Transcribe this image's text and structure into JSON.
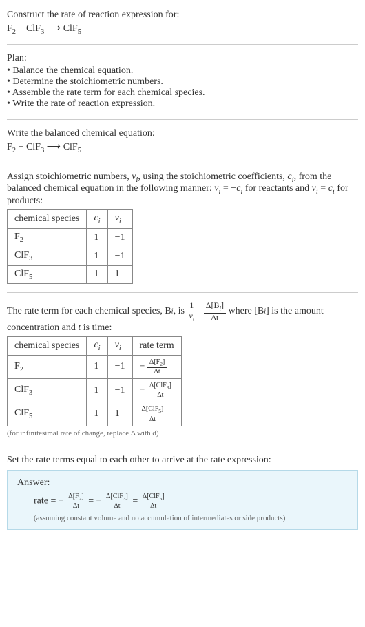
{
  "intro": {
    "prompt": "Construct the rate of reaction expression for:",
    "equation_lhs1": "F",
    "equation_lhs1_sub": "2",
    "plus": " + ",
    "equation_lhs2": "ClF",
    "equation_lhs2_sub": "3",
    "arrow": " ⟶ ",
    "equation_rhs": "ClF",
    "equation_rhs_sub": "5"
  },
  "plan": {
    "heading": "Plan:",
    "items": [
      "Balance the chemical equation.",
      "Determine the stoichiometric numbers.",
      "Assemble the rate term for each chemical species.",
      "Write the rate of reaction expression."
    ]
  },
  "balance": {
    "heading": "Write the balanced chemical equation:"
  },
  "assign": {
    "text_a": "Assign stoichiometric numbers, ",
    "nu_i": "ν",
    "i_sub": "i",
    "text_b": ", using the stoichiometric coefficients, ",
    "c_i": "c",
    "text_c": ", from the balanced chemical equation in the following manner: ",
    "rel1_lhs": "ν",
    "rel1_eq": " = −",
    "rel1_rhs": "c",
    "text_d": " for reactants and ",
    "rel2_eq": " = ",
    "text_e": " for products:"
  },
  "table1": {
    "h1": "chemical species",
    "h2": "c",
    "h2_sub": "i",
    "h3": "ν",
    "h3_sub": "i",
    "rows": [
      {
        "sp": "F",
        "sp_sub": "2",
        "c": "1",
        "nu": "−1"
      },
      {
        "sp": "ClF",
        "sp_sub": "3",
        "c": "1",
        "nu": "−1"
      },
      {
        "sp": "ClF",
        "sp_sub": "5",
        "c": "1",
        "nu": "1"
      }
    ]
  },
  "rateterm": {
    "text_a": "The rate term for each chemical species, B",
    "i_sub": "i",
    "text_b": ", is ",
    "frac1_num": "1",
    "frac1_den_a": "ν",
    "frac2_num_a": "Δ[B",
    "frac2_num_b": "]",
    "frac2_den": "Δt",
    "text_c": " where [B",
    "text_d": "] is the amount concentration and ",
    "t_var": "t",
    "text_e": " is time:"
  },
  "table2": {
    "h1": "chemical species",
    "h2": "c",
    "h2_sub": "i",
    "h3": "ν",
    "h3_sub": "i",
    "h4": "rate term",
    "rows": [
      {
        "sp": "F",
        "sp_sub": "2",
        "c": "1",
        "nu": "−1",
        "rt_sign": "−",
        "rt_num_a": "Δ[F",
        "rt_num_sub": "2",
        "rt_num_b": "]",
        "rt_den": "Δt"
      },
      {
        "sp": "ClF",
        "sp_sub": "3",
        "c": "1",
        "nu": "−1",
        "rt_sign": "−",
        "rt_num_a": "Δ[ClF",
        "rt_num_sub": "3",
        "rt_num_b": "]",
        "rt_den": "Δt"
      },
      {
        "sp": "ClF",
        "sp_sub": "5",
        "c": "1",
        "nu": "1",
        "rt_sign": "",
        "rt_num_a": "Δ[ClF",
        "rt_num_sub": "5",
        "rt_num_b": "]",
        "rt_den": "Δt"
      }
    ]
  },
  "note1": "(for infinitesimal rate of change, replace Δ with d)",
  "setequal": "Set the rate terms equal to each other to arrive at the rate expression:",
  "answer": {
    "label": "Answer:",
    "rate_lhs": "rate = −",
    "eq": " = ",
    "neg": "−",
    "f1_num_a": "Δ[F",
    "f1_num_sub": "2",
    "f1_num_b": "]",
    "f1_den": "Δt",
    "f2_num_a": "Δ[ClF",
    "f2_num_sub": "3",
    "f2_num_b": "]",
    "f2_den": "Δt",
    "f3_num_a": "Δ[ClF",
    "f3_num_sub": "5",
    "f3_num_b": "]",
    "f3_den": "Δt",
    "assume": "(assuming constant volume and no accumulation of intermediates or side products)"
  }
}
